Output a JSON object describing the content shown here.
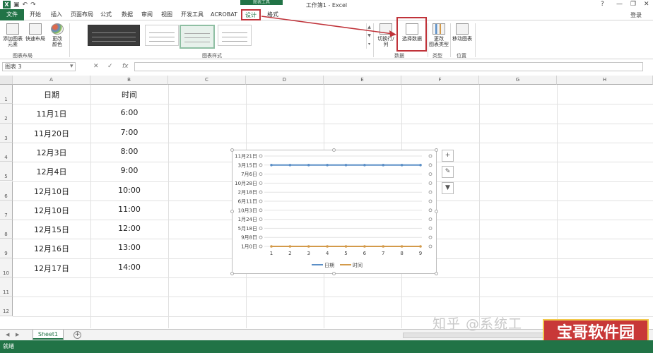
{
  "titlebar": {
    "document_title": "工作簿1 - Excel",
    "contextual_group": "图表工具",
    "window_controls": [
      "?",
      "—",
      "❐",
      "✕"
    ]
  },
  "tabs": {
    "file": "文件",
    "items": [
      "开始",
      "插入",
      "页面布局",
      "公式",
      "数据",
      "审阅",
      "视图",
      "开发工具",
      "ACROBAT",
      "设计",
      "格式"
    ],
    "active": "设计",
    "login": "登录"
  },
  "ribbon": {
    "add_element": "添加图表\n元素",
    "quick_layout": "快速布局",
    "change_colors": "更改\n颜色",
    "group_layout": "图表布局",
    "group_styles": "图表样式",
    "switch_row_col": "切换行/列",
    "select_data": "选择数据",
    "group_data": "数据",
    "change_type": "更改\n图表类型",
    "group_type": "类型",
    "move_chart": "移动图表",
    "group_location": "位置"
  },
  "formula_bar": {
    "name_box": "图表 3",
    "cancel": "✕",
    "confirm": "✓",
    "fx": "fx",
    "value": ""
  },
  "grid": {
    "columns": [
      "A",
      "B",
      "C",
      "D",
      "E",
      "F",
      "G",
      "H"
    ],
    "rows": [
      "1",
      "2",
      "3",
      "4",
      "5",
      "6",
      "7",
      "8",
      "9",
      "10",
      "11",
      "12"
    ],
    "header": [
      "日期",
      "时间"
    ],
    "data": [
      [
        "11月1日",
        "6:00"
      ],
      [
        "11月20日",
        "7:00"
      ],
      [
        "12月3日",
        "8:00"
      ],
      [
        "12月4日",
        "9:00"
      ],
      [
        "12月10日",
        "10:00"
      ],
      [
        "12月10日",
        "11:00"
      ],
      [
        "12月15日",
        "12:00"
      ],
      [
        "12月16日",
        "13:00"
      ],
      [
        "12月17日",
        "14:00"
      ]
    ]
  },
  "chart_data": {
    "type": "line",
    "x": [
      1,
      2,
      3,
      4,
      5,
      6,
      7,
      8,
      9
    ],
    "y_tick_labels": [
      "11月21日",
      "3月15日",
      "7月6日",
      "10月28日",
      "2月18日",
      "6月11日",
      "10月3日",
      "1月24日",
      "5月18日",
      "9月8日",
      "1月0日"
    ],
    "series": [
      {
        "name": "日期",
        "level": "3月15日",
        "color": "#5b8fc7"
      },
      {
        "name": "时间",
        "level": "1月0日",
        "color": "#d39a4a"
      }
    ],
    "grid": true,
    "legend": "bottom"
  },
  "sheets": {
    "tabs": [
      "Sheet1"
    ],
    "add": "+"
  },
  "status": {
    "text": "就绪"
  },
  "overlay": {
    "watermark": "知乎 @系统工",
    "badge": "宝哥软件园"
  }
}
